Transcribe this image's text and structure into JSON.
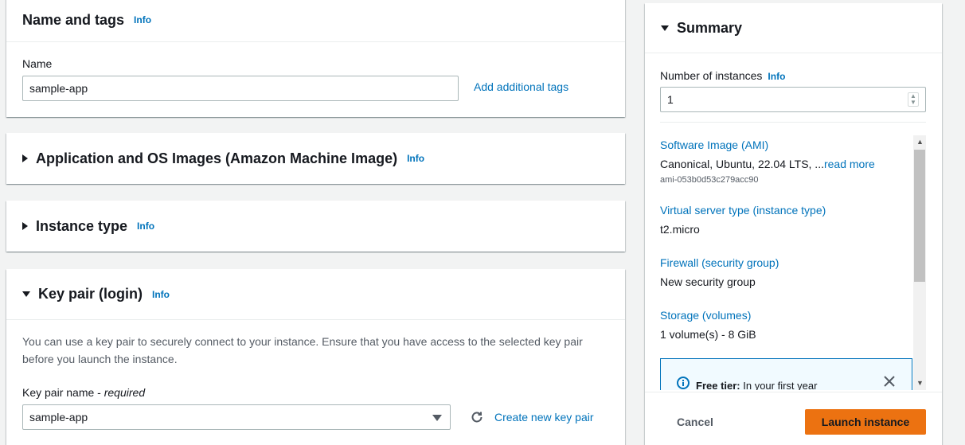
{
  "name_tags": {
    "title": "Name and tags",
    "info": "Info",
    "name_label": "Name",
    "name_value": "sample-app",
    "add_tags": "Add additional tags"
  },
  "ami": {
    "title": "Application and OS Images (Amazon Machine Image)",
    "info": "Info"
  },
  "instance_type": {
    "title": "Instance type",
    "info": "Info"
  },
  "key_pair": {
    "title": "Key pair (login)",
    "info": "Info",
    "description": "You can use a key pair to securely connect to your instance. Ensure that you have access to the selected key pair before you launch the instance.",
    "name_label": "Key pair name",
    "required": "required",
    "selected": "sample-app",
    "create_link": "Create new key pair"
  },
  "summary": {
    "title": "Summary",
    "instances_label": "Number of instances",
    "info": "Info",
    "instances_value": "1",
    "software_image_label": "Software Image (AMI)",
    "software_image_value": "Canonical, Ubuntu, 22.04 LTS, ...",
    "read_more": "read more",
    "ami_id": "ami-053b0d53c279acc90",
    "server_type_label": "Virtual server type (instance type)",
    "server_type_value": "t2.micro",
    "firewall_label": "Firewall (security group)",
    "firewall_value": "New security group",
    "storage_label": "Storage (volumes)",
    "storage_value": "1 volume(s) - 8 GiB",
    "free_tier_label": "Free tier:",
    "free_tier_text": " In your first year",
    "cancel": "Cancel",
    "launch": "Launch instance"
  },
  "colors": {
    "link": "#0073bb",
    "primary": "#ec7211",
    "border": "#aab7b8"
  }
}
